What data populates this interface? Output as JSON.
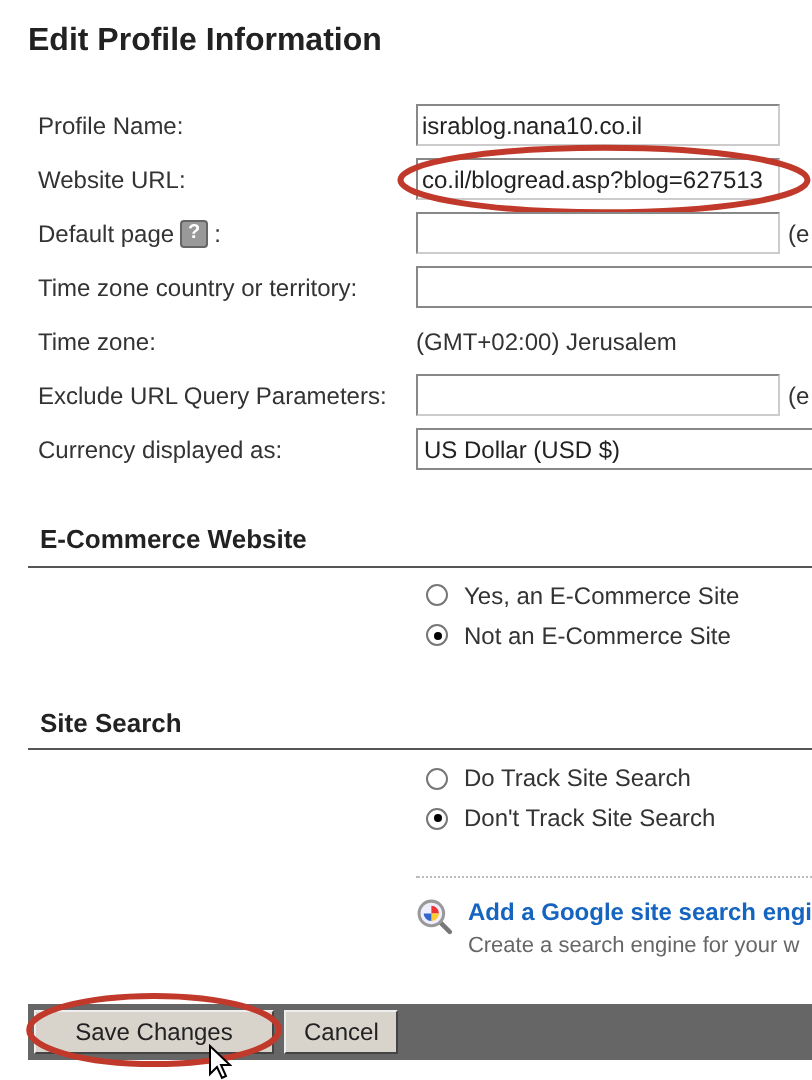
{
  "title": "Edit Profile Information",
  "fields": [
    {
      "kind": "input",
      "label": "Profile Name:",
      "value": "israblog.nana10.co.il"
    },
    {
      "kind": "input",
      "label": "Website URL:",
      "value": "co.il/blogread.asp?blog=627513",
      "highlighted": true
    },
    {
      "kind": "input",
      "label": "Default page",
      "help": "?",
      "label_end": ":",
      "suffix": "(e"
    },
    {
      "kind": "select",
      "label": "Time zone country or territory:"
    },
    {
      "kind": "text",
      "label": "Time zone:",
      "value": "(GMT+02:00) Jerusalem"
    },
    {
      "kind": "input",
      "label": "Exclude URL Query Parameters:",
      "suffix": "(e"
    },
    {
      "kind": "select",
      "label": "Currency displayed as:",
      "value": "US Dollar (USD $)"
    }
  ],
  "sections": [
    {
      "heading": "E-Commerce Website",
      "options": [
        {
          "label": "Yes, an E-Commerce Site",
          "selected": false
        },
        {
          "label": "Not an E-Commerce Site",
          "selected": true
        }
      ]
    },
    {
      "heading": "Site Search",
      "options": [
        {
          "label": "Do Track Site Search",
          "selected": false
        },
        {
          "label": "Don't Track Site Search",
          "selected": true
        }
      ]
    }
  ],
  "promo": {
    "link": "Add a Google site search engi",
    "description": "Create a search engine for your w"
  },
  "buttons": [
    {
      "label": "Save Changes",
      "highlighted": true
    },
    {
      "label": "Cancel",
      "highlighted": false
    }
  ]
}
